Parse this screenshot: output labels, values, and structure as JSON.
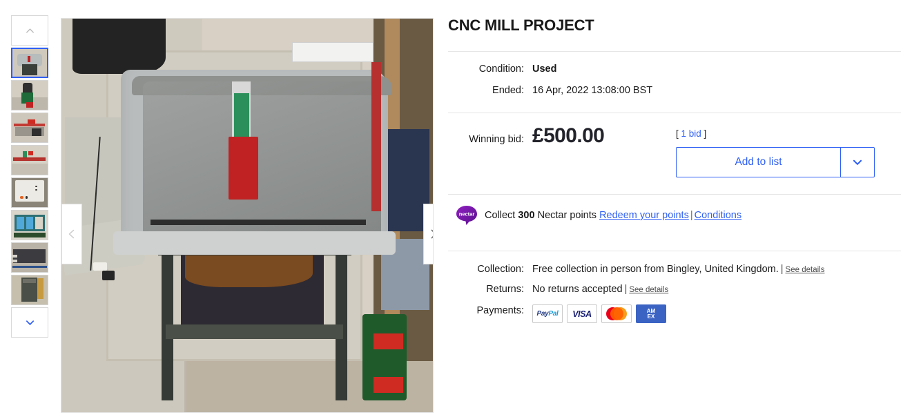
{
  "gallery": {
    "scroll_up_icon": "chevron-up-icon",
    "scroll_down_icon": "chevron-down-icon",
    "prev_icon": "chevron-left-icon",
    "next_icon": "chevron-right-icon",
    "thumbnails": [
      {
        "alt": "CNC mill in grey enclosure on metal stand",
        "selected": true
      },
      {
        "alt": "Close up of spindle head with green motor",
        "selected": false
      },
      {
        "alt": "Machine bed with red linear rails",
        "selected": false
      },
      {
        "alt": "Top view of red axis rails and bed",
        "selected": false
      },
      {
        "alt": "White control cabinet front panel",
        "selected": false
      },
      {
        "alt": "Control cabinet interior with blue drives",
        "selected": false
      },
      {
        "alt": "Box of cables and components",
        "selected": false
      },
      {
        "alt": "Tall control cabinet beside machine",
        "selected": false
      }
    ]
  },
  "listing": {
    "title": "CNC MILL PROJECT",
    "condition_label": "Condition:",
    "condition_value": "Used",
    "ended_label": "Ended:",
    "ended_value": "16 Apr, 2022  13:08:00 BST",
    "winning_bid_label": "Winning bid:",
    "price": "£500.00",
    "bid_count_open": "[ ",
    "bid_count_link": "1 bid",
    "bid_count_close": " ]",
    "add_to_list_label": "Add to list",
    "add_to_list_caret_icon": "chevron-down-icon"
  },
  "nectar": {
    "logo_icon": "nectar-logo-icon",
    "logo_text": "nectar",
    "collect_text": "Collect ",
    "points": "300",
    "points_text": " Nectar points ",
    "redeem_link": "Redeem your points",
    "separator": "|",
    "conditions_link": "Conditions"
  },
  "details": {
    "collection_label": "Collection:",
    "collection_value": "Free collection in person from Bingley, United Kingdom.",
    "collection_pipe": "|",
    "collection_link": "See details",
    "returns_label": "Returns:",
    "returns_value": "No returns accepted",
    "returns_pipe": "|",
    "returns_link": "See details",
    "payments_label": "Payments:",
    "payment_methods": [
      {
        "name": "paypal-icon",
        "label": "PayPal"
      },
      {
        "name": "visa-icon",
        "label": "VISA"
      },
      {
        "name": "mastercard-icon",
        "label": "Mastercard"
      },
      {
        "name": "amex-icon",
        "label": "AMEX"
      }
    ]
  },
  "colors": {
    "accent_blue": "#2f5ff4",
    "nectar_purple": "#7b1fa2",
    "text_primary": "#191919"
  }
}
